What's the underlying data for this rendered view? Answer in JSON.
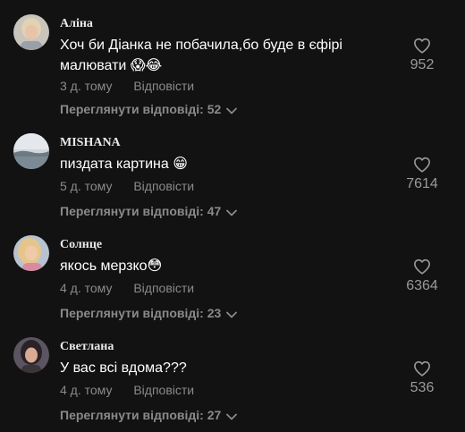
{
  "comments": [
    {
      "username": "Аліна",
      "text": "Хоч би Діанка не побачила,бо буде в єфірі малювати 😱😂",
      "time": "3 д. тому",
      "reply_label": "Відповісти",
      "view_replies": "Переглянути відповіді: 52",
      "likes": "952"
    },
    {
      "username": "MISHANA",
      "text": "пиздата картина 😁",
      "time": "5 д. тому",
      "reply_label": "Відповісти",
      "view_replies": "Переглянути відповіді: 47",
      "likes": "7614"
    },
    {
      "username": "Солнце",
      "text": "якось мерзко😳",
      "time": "4 д. тому",
      "reply_label": "Відповісти",
      "view_replies": "Переглянути відповіді: 23",
      "likes": "6364"
    },
    {
      "username": "Светлана",
      "text": "У вас всі вдома???",
      "time": "4 д. тому",
      "reply_label": "Відповісти",
      "view_replies": "Переглянути відповіді: 27",
      "likes": "536"
    }
  ],
  "colors": {
    "background": "#121212",
    "text": "#ffffff",
    "muted": "#8a8a8a"
  },
  "icons": {
    "like": "heart-outline-icon",
    "expand": "chevron-down-icon"
  }
}
